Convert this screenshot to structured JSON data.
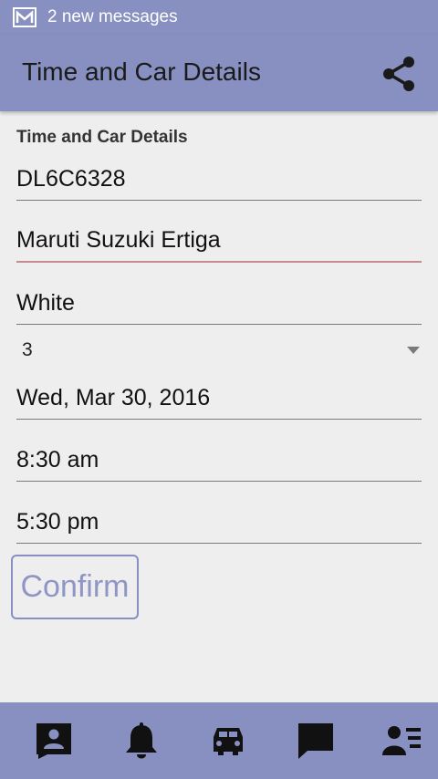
{
  "status_bar": {
    "notification": "2 new messages",
    "icon": "mail-icon"
  },
  "app_bar": {
    "title": "Time and Car Details",
    "share_icon": "share-icon"
  },
  "form": {
    "section_label": "Time and Car Details",
    "car_number": "DL6C6328",
    "car_model": "Maruti Suzuki Ertiga",
    "car_color": "White",
    "seats_selected": "3",
    "date": "Wed, Mar 30, 2016",
    "start_time": "8:30 am",
    "end_time": "5:30 pm",
    "confirm_label": "Confirm"
  },
  "bottom_nav": {
    "items": [
      "contact-card-icon",
      "bell-icon",
      "car-icon",
      "chat-icon",
      "user-list-icon"
    ]
  },
  "colors": {
    "primary": "#8790c0",
    "background": "#eeeeee",
    "focus_underline": "#c58a94"
  }
}
